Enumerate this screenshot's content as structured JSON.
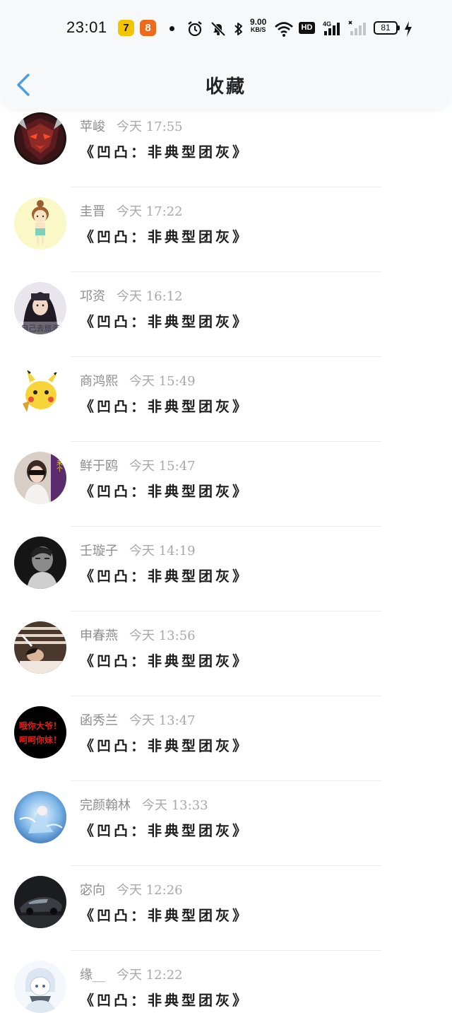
{
  "status_bar": {
    "time": "23:01",
    "app_badge_1": "7",
    "app_badge_2": "8",
    "net_speed_value": "9.00",
    "net_speed_unit": "KB/S",
    "hd_badge": "HD",
    "network_type": "4G",
    "battery_level": "81"
  },
  "header": {
    "title": "收藏"
  },
  "favorites": [
    {
      "user": "苹峻",
      "time": "今天 17:55",
      "title": "《凹凸：非典型团灰》",
      "avatar": "avatar-dark-warrior"
    },
    {
      "user": "圭晋",
      "time": "今天 17:22",
      "title": "《凹凸：非典型团灰》",
      "avatar": "avatar-cartoon-girl"
    },
    {
      "user": "邛资",
      "time": "今天 16:12",
      "title": "《凹凸：非典型团灰》",
      "avatar": "avatar-hooded-girl"
    },
    {
      "user": "商鸿熙",
      "time": "今天 15:49",
      "title": "《凹凸：非典型团灰》",
      "avatar": "avatar-pikachu"
    },
    {
      "user": "鲜于鸥",
      "time": "今天 15:47",
      "title": "《凹凸：非典型团灰》",
      "avatar": "avatar-sunglasses-girl"
    },
    {
      "user": "壬璇子",
      "time": "今天 14:19",
      "title": "《凹凸：非典型团灰》",
      "avatar": "avatar-bw-portrait"
    },
    {
      "user": "申春燕",
      "time": "今天 13:56",
      "title": "《凹凸：非典型团灰》",
      "avatar": "avatar-lying-person"
    },
    {
      "user": "函秀兰",
      "time": "今天 13:47",
      "title": "《凹凸：非典型团灰》",
      "avatar": "avatar-red-text"
    },
    {
      "user": "完颜翰林",
      "time": "今天 13:33",
      "title": "《凹凸：非典型团灰》",
      "avatar": "avatar-anime-blue"
    },
    {
      "user": "宓向",
      "time": "今天 12:26",
      "title": "《凹凸：非典型团灰》",
      "avatar": "avatar-sports-car"
    },
    {
      "user": "缘__",
      "time": "今天 12:22",
      "title": "《凹凸：非典型团灰》",
      "avatar": "avatar-sketch-girl"
    }
  ],
  "avatar_text": {
    "hooded_caption": "自己去旅游",
    "red_line_1": "哦你大爷！",
    "red_line_2": "呵呵你妹！",
    "side_text": "来个"
  },
  "colors": {
    "accent": "#4a9fe0",
    "header_bg": "#f7f8fa",
    "meta_text": "#8d8d8d",
    "title_text": "#1c1c1c"
  }
}
